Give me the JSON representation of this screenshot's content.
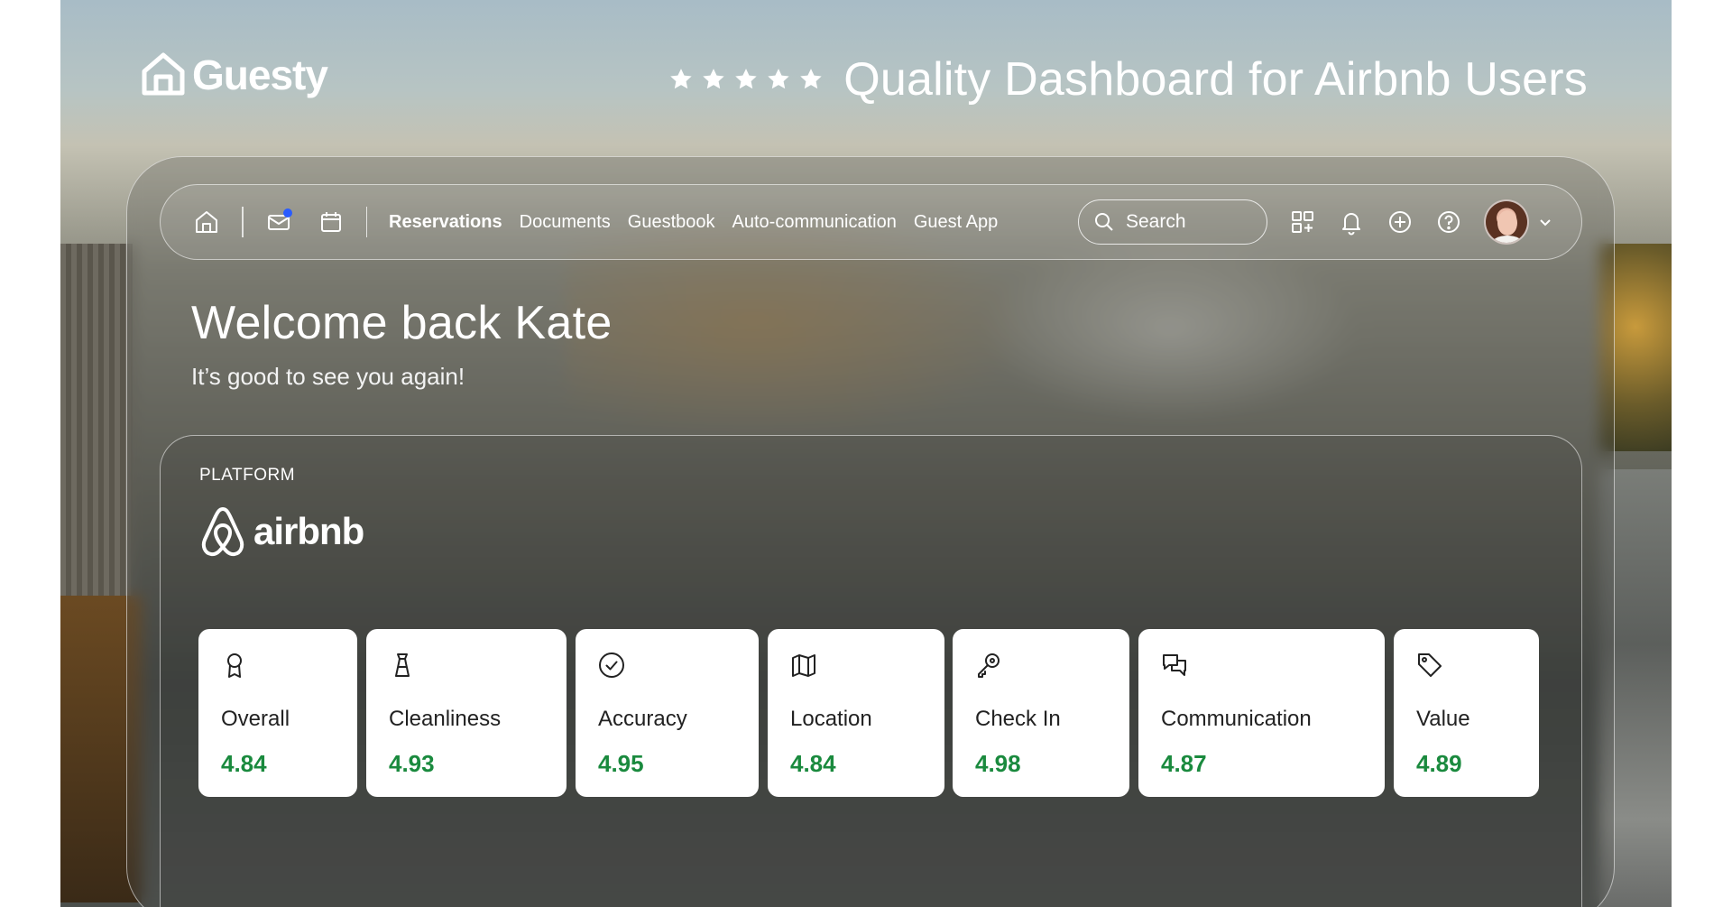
{
  "brand": {
    "name": "Guesty"
  },
  "headline": {
    "stars": 5,
    "text": "Quality Dashboard for Airbnb Users"
  },
  "nav": {
    "icons": [
      "home-icon",
      "mail-icon",
      "calendar-icon"
    ],
    "items": [
      {
        "label": "Reservations",
        "active": true
      },
      {
        "label": "Documents",
        "active": false
      },
      {
        "label": "Guestbook",
        "active": false
      },
      {
        "label": "Auto-communication",
        "active": false
      },
      {
        "label": "Guest App",
        "active": false
      }
    ],
    "search": {
      "placeholder": "Search"
    },
    "tools": [
      "apps-add-icon",
      "bell-icon",
      "plus-circle-icon",
      "help-icon"
    ]
  },
  "welcome": {
    "title": "Welcome back Kate",
    "subtitle": "It’s good to see you again!"
  },
  "platform": {
    "label": "PLATFORM",
    "name": "airbnb"
  },
  "metrics": [
    {
      "label": "Overall",
      "value": "4.84",
      "icon": "award-icon"
    },
    {
      "label": "Cleanliness",
      "value": "4.93",
      "icon": "spray-bottle-icon"
    },
    {
      "label": "Accuracy",
      "value": "4.95",
      "icon": "check-circle-icon"
    },
    {
      "label": "Location",
      "value": "4.84",
      "icon": "map-icon"
    },
    {
      "label": "Check In",
      "value": "4.98",
      "icon": "key-icon"
    },
    {
      "label": "Communication",
      "value": "4.87",
      "icon": "chat-icon"
    },
    {
      "label": "Value",
      "value": "4.89",
      "icon": "tag-icon"
    }
  ],
  "colors": {
    "metric_value": "#1a8a3e",
    "notification_dot": "#2a5cff",
    "card_background": "#ffffff"
  }
}
